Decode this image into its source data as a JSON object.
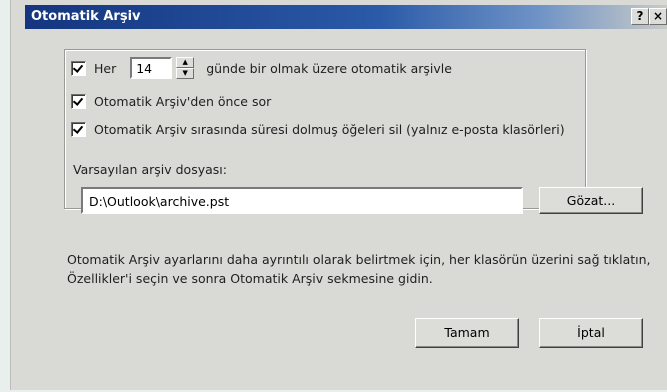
{
  "dialog": {
    "title": "Otomatik Arşiv",
    "help_label": "?",
    "close_label": "×"
  },
  "settings": {
    "every_label": "Her",
    "days_value": "14",
    "spin_up": "▲",
    "spin_down": "▼",
    "every_suffix": "günde bir olmak üzere otomatik arşivle",
    "prompt_label": "Otomatik Arşiv'den önce sor",
    "delete_label": "Otomatik Arşiv sırasında süresi dolmuş öğeleri sil (yalnız e-posta klasörleri)",
    "default_file_label": "Varsayılan arşiv dosyası:",
    "default_file_value": "D:\\Outlook\\archive.pst",
    "browse_label": "Gözat..."
  },
  "info": {
    "text": "Otomatik Arşiv ayarlarını daha ayrıntılı olarak belirtmek için, her klasörün üzerini sağ tıklatın, Özellikler'i seçin ve sonra Otomatik Arşiv sekmesine gidin."
  },
  "buttons": {
    "ok": "Tamam",
    "cancel": "İptal"
  }
}
